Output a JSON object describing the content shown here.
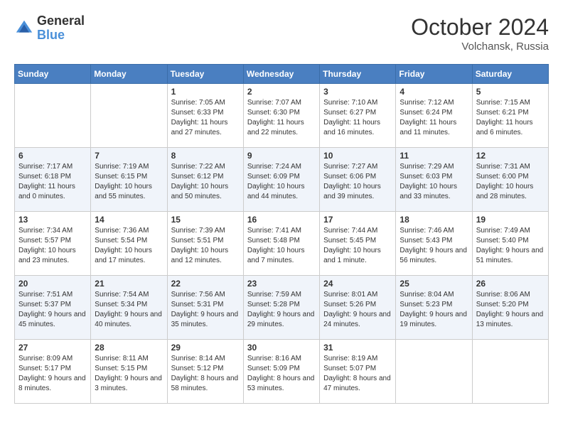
{
  "header": {
    "logo_general": "General",
    "logo_blue": "Blue",
    "month": "October 2024",
    "location": "Volchansk, Russia"
  },
  "days_of_week": [
    "Sunday",
    "Monday",
    "Tuesday",
    "Wednesday",
    "Thursday",
    "Friday",
    "Saturday"
  ],
  "weeks": [
    [
      {
        "day": "",
        "sunrise": "",
        "sunset": "",
        "daylight": ""
      },
      {
        "day": "",
        "sunrise": "",
        "sunset": "",
        "daylight": ""
      },
      {
        "day": "1",
        "sunrise": "Sunrise: 7:05 AM",
        "sunset": "Sunset: 6:33 PM",
        "daylight": "Daylight: 11 hours and 27 minutes."
      },
      {
        "day": "2",
        "sunrise": "Sunrise: 7:07 AM",
        "sunset": "Sunset: 6:30 PM",
        "daylight": "Daylight: 11 hours and 22 minutes."
      },
      {
        "day": "3",
        "sunrise": "Sunrise: 7:10 AM",
        "sunset": "Sunset: 6:27 PM",
        "daylight": "Daylight: 11 hours and 16 minutes."
      },
      {
        "day": "4",
        "sunrise": "Sunrise: 7:12 AM",
        "sunset": "Sunset: 6:24 PM",
        "daylight": "Daylight: 11 hours and 11 minutes."
      },
      {
        "day": "5",
        "sunrise": "Sunrise: 7:15 AM",
        "sunset": "Sunset: 6:21 PM",
        "daylight": "Daylight: 11 hours and 6 minutes."
      }
    ],
    [
      {
        "day": "6",
        "sunrise": "Sunrise: 7:17 AM",
        "sunset": "Sunset: 6:18 PM",
        "daylight": "Daylight: 11 hours and 0 minutes."
      },
      {
        "day": "7",
        "sunrise": "Sunrise: 7:19 AM",
        "sunset": "Sunset: 6:15 PM",
        "daylight": "Daylight: 10 hours and 55 minutes."
      },
      {
        "day": "8",
        "sunrise": "Sunrise: 7:22 AM",
        "sunset": "Sunset: 6:12 PM",
        "daylight": "Daylight: 10 hours and 50 minutes."
      },
      {
        "day": "9",
        "sunrise": "Sunrise: 7:24 AM",
        "sunset": "Sunset: 6:09 PM",
        "daylight": "Daylight: 10 hours and 44 minutes."
      },
      {
        "day": "10",
        "sunrise": "Sunrise: 7:27 AM",
        "sunset": "Sunset: 6:06 PM",
        "daylight": "Daylight: 10 hours and 39 minutes."
      },
      {
        "day": "11",
        "sunrise": "Sunrise: 7:29 AM",
        "sunset": "Sunset: 6:03 PM",
        "daylight": "Daylight: 10 hours and 33 minutes."
      },
      {
        "day": "12",
        "sunrise": "Sunrise: 7:31 AM",
        "sunset": "Sunset: 6:00 PM",
        "daylight": "Daylight: 10 hours and 28 minutes."
      }
    ],
    [
      {
        "day": "13",
        "sunrise": "Sunrise: 7:34 AM",
        "sunset": "Sunset: 5:57 PM",
        "daylight": "Daylight: 10 hours and 23 minutes."
      },
      {
        "day": "14",
        "sunrise": "Sunrise: 7:36 AM",
        "sunset": "Sunset: 5:54 PM",
        "daylight": "Daylight: 10 hours and 17 minutes."
      },
      {
        "day": "15",
        "sunrise": "Sunrise: 7:39 AM",
        "sunset": "Sunset: 5:51 PM",
        "daylight": "Daylight: 10 hours and 12 minutes."
      },
      {
        "day": "16",
        "sunrise": "Sunrise: 7:41 AM",
        "sunset": "Sunset: 5:48 PM",
        "daylight": "Daylight: 10 hours and 7 minutes."
      },
      {
        "day": "17",
        "sunrise": "Sunrise: 7:44 AM",
        "sunset": "Sunset: 5:45 PM",
        "daylight": "Daylight: 10 hours and 1 minute."
      },
      {
        "day": "18",
        "sunrise": "Sunrise: 7:46 AM",
        "sunset": "Sunset: 5:43 PM",
        "daylight": "Daylight: 9 hours and 56 minutes."
      },
      {
        "day": "19",
        "sunrise": "Sunrise: 7:49 AM",
        "sunset": "Sunset: 5:40 PM",
        "daylight": "Daylight: 9 hours and 51 minutes."
      }
    ],
    [
      {
        "day": "20",
        "sunrise": "Sunrise: 7:51 AM",
        "sunset": "Sunset: 5:37 PM",
        "daylight": "Daylight: 9 hours and 45 minutes."
      },
      {
        "day": "21",
        "sunrise": "Sunrise: 7:54 AM",
        "sunset": "Sunset: 5:34 PM",
        "daylight": "Daylight: 9 hours and 40 minutes."
      },
      {
        "day": "22",
        "sunrise": "Sunrise: 7:56 AM",
        "sunset": "Sunset: 5:31 PM",
        "daylight": "Daylight: 9 hours and 35 minutes."
      },
      {
        "day": "23",
        "sunrise": "Sunrise: 7:59 AM",
        "sunset": "Sunset: 5:28 PM",
        "daylight": "Daylight: 9 hours and 29 minutes."
      },
      {
        "day": "24",
        "sunrise": "Sunrise: 8:01 AM",
        "sunset": "Sunset: 5:26 PM",
        "daylight": "Daylight: 9 hours and 24 minutes."
      },
      {
        "day": "25",
        "sunrise": "Sunrise: 8:04 AM",
        "sunset": "Sunset: 5:23 PM",
        "daylight": "Daylight: 9 hours and 19 minutes."
      },
      {
        "day": "26",
        "sunrise": "Sunrise: 8:06 AM",
        "sunset": "Sunset: 5:20 PM",
        "daylight": "Daylight: 9 hours and 13 minutes."
      }
    ],
    [
      {
        "day": "27",
        "sunrise": "Sunrise: 8:09 AM",
        "sunset": "Sunset: 5:17 PM",
        "daylight": "Daylight: 9 hours and 8 minutes."
      },
      {
        "day": "28",
        "sunrise": "Sunrise: 8:11 AM",
        "sunset": "Sunset: 5:15 PM",
        "daylight": "Daylight: 9 hours and 3 minutes."
      },
      {
        "day": "29",
        "sunrise": "Sunrise: 8:14 AM",
        "sunset": "Sunset: 5:12 PM",
        "daylight": "Daylight: 8 hours and 58 minutes."
      },
      {
        "day": "30",
        "sunrise": "Sunrise: 8:16 AM",
        "sunset": "Sunset: 5:09 PM",
        "daylight": "Daylight: 8 hours and 53 minutes."
      },
      {
        "day": "31",
        "sunrise": "Sunrise: 8:19 AM",
        "sunset": "Sunset: 5:07 PM",
        "daylight": "Daylight: 8 hours and 47 minutes."
      },
      {
        "day": "",
        "sunrise": "",
        "sunset": "",
        "daylight": ""
      },
      {
        "day": "",
        "sunrise": "",
        "sunset": "",
        "daylight": ""
      }
    ]
  ]
}
